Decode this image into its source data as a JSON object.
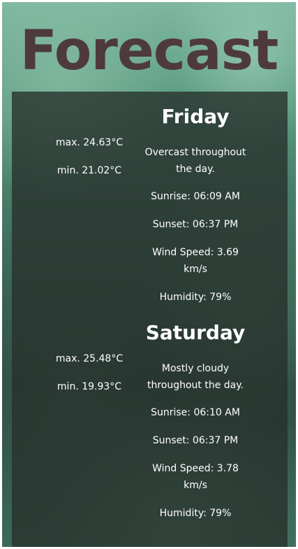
{
  "page": {
    "title": "Forecast"
  },
  "days": [
    {
      "name": "Friday",
      "max": "max. 24.63°C",
      "min": "min. 21.02°C",
      "summary": "Overcast throughout the day.",
      "sunrise": "Sunrise: 06:09 AM",
      "sunset": "Sunset: 06:37 PM",
      "wind": "Wind Speed: 3.69 km/s",
      "humidity": "Humidity: 79%"
    },
    {
      "name": "Saturday",
      "max": "max. 25.48°C",
      "min": "min. 19.93°C",
      "summary": "Mostly cloudy throughout the day.",
      "sunrise": "Sunrise: 06:10 AM",
      "sunset": "Sunset: 06:37 PM",
      "wind": "Wind Speed: 3.78 km/s",
      "humidity": "Humidity: 79%"
    }
  ],
  "colors": {
    "title": "#4e3a3e",
    "panel": "#26302c",
    "text": "#ffffff"
  }
}
